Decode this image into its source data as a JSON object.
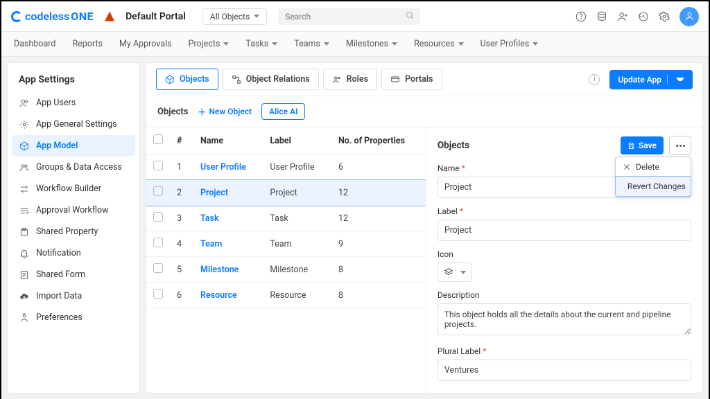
{
  "header": {
    "logo_text": "codeless",
    "logo_suffix": "ONE",
    "portal_name": "Default Portal",
    "object_selector": "All Objects",
    "search_placeholder": "Search"
  },
  "nav": {
    "items": [
      "Dashboard",
      "Reports",
      "My Approvals",
      "Projects",
      "Tasks",
      "Teams",
      "Milestones",
      "Resources",
      "User Profiles"
    ],
    "has_caret": [
      false,
      false,
      false,
      true,
      true,
      true,
      true,
      true,
      true
    ]
  },
  "sidebar": {
    "title": "App Settings",
    "items": [
      {
        "label": "App Users",
        "icon": "users-icon"
      },
      {
        "label": "App General Settings",
        "icon": "gear-icon"
      },
      {
        "label": "App Model",
        "icon": "cube-icon",
        "active": true
      },
      {
        "label": "Groups & Data Access",
        "icon": "group-icon"
      },
      {
        "label": "Workflow Builder",
        "icon": "workflow-icon"
      },
      {
        "label": "Approval Workflow",
        "icon": "approval-icon"
      },
      {
        "label": "Shared Property",
        "icon": "share-icon"
      },
      {
        "label": "Notification",
        "icon": "bell-icon"
      },
      {
        "label": "Shared Form",
        "icon": "form-icon"
      },
      {
        "label": "Import Data",
        "icon": "cloud-icon"
      },
      {
        "label": "Preferences",
        "icon": "pref-icon"
      }
    ]
  },
  "tabs": {
    "items": [
      {
        "label": "Objects",
        "icon": "cube-icon",
        "active": true
      },
      {
        "label": "Object Relations",
        "icon": "relations-icon"
      },
      {
        "label": "Roles",
        "icon": "roles-icon"
      },
      {
        "label": "Portals",
        "icon": "portal-icon"
      }
    ],
    "update_btn": "Update App"
  },
  "subbar": {
    "crumb": "Objects",
    "new_object": "New Object",
    "alice": "Alice AI"
  },
  "table": {
    "headers": {
      "num": "#",
      "name": "Name",
      "label": "Label",
      "props": "No. of Properties"
    },
    "rows": [
      {
        "num": "1",
        "name": "User Profile",
        "label": "User Profile",
        "props": "6",
        "selected": false
      },
      {
        "num": "2",
        "name": "Project",
        "label": "Project",
        "props": "12",
        "selected": true
      },
      {
        "num": "3",
        "name": "Task",
        "label": "Task",
        "props": "12",
        "selected": false
      },
      {
        "num": "4",
        "name": "Team",
        "label": "Team",
        "props": "9",
        "selected": false
      },
      {
        "num": "5",
        "name": "Milestone",
        "label": "Milestone",
        "props": "8",
        "selected": false
      },
      {
        "num": "6",
        "name": "Resource",
        "label": "Resource",
        "props": "8",
        "selected": false
      }
    ]
  },
  "detail": {
    "title": "Objects",
    "save": "Save",
    "dropdown": {
      "delete": "Delete",
      "revert": "Revert Changes"
    },
    "fields": {
      "name_label": "Name",
      "name_value": "Project",
      "label_label": "Label",
      "label_value": "Project",
      "icon_label": "Icon",
      "desc_label": "Description",
      "desc_value": "This object holds all the details about the current and pipeline projects.",
      "plural_label": "Plural Label",
      "plural_value": "Ventures"
    }
  }
}
